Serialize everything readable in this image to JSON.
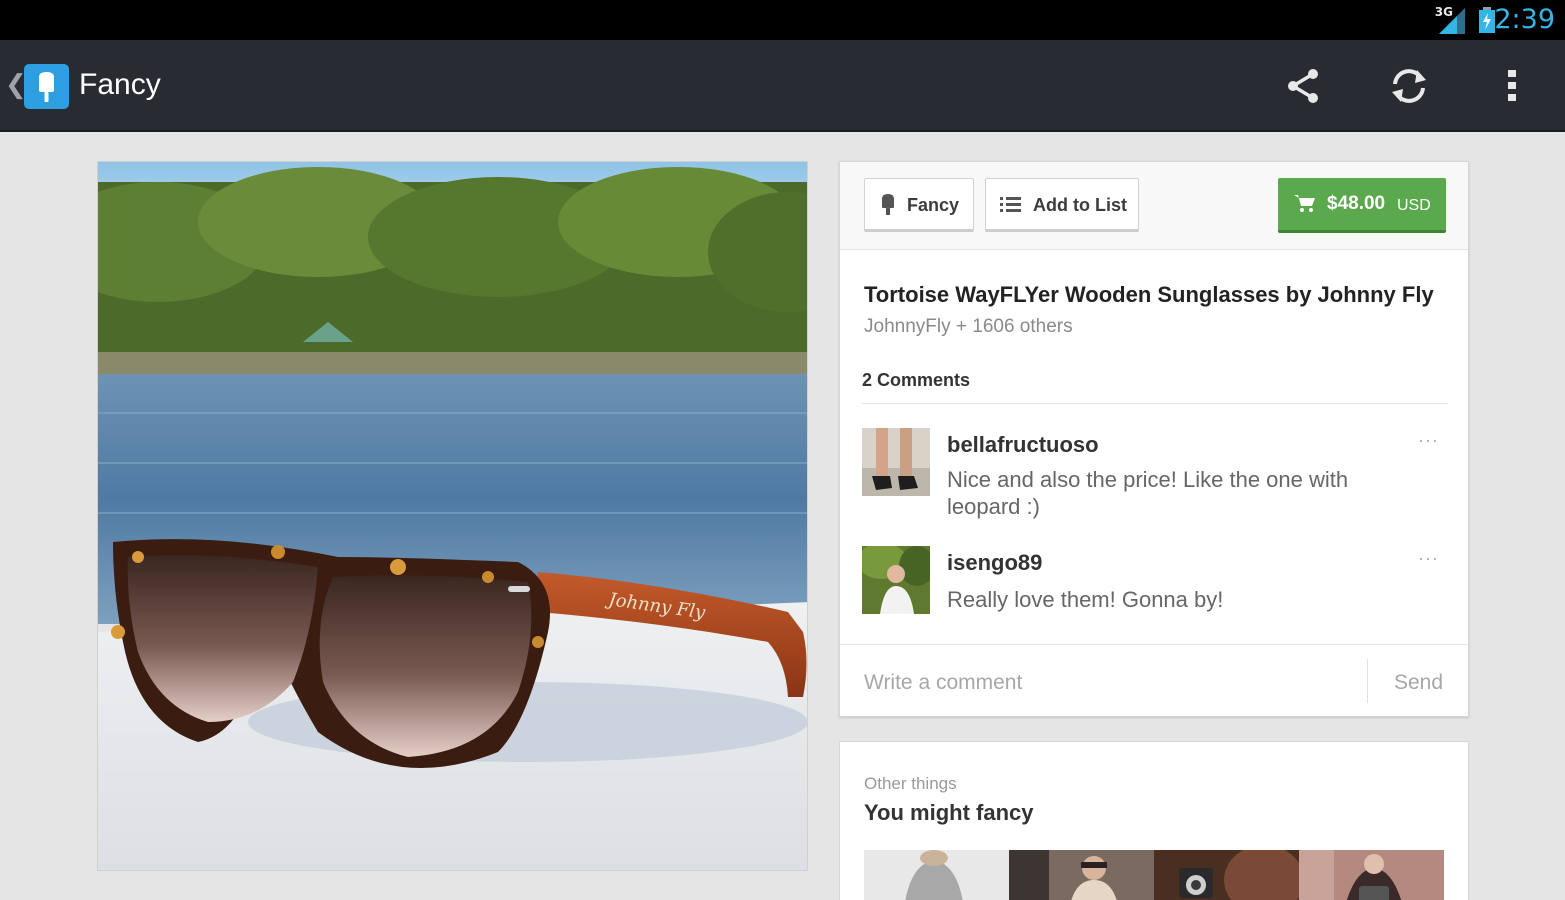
{
  "status_bar": {
    "network": "3G",
    "time": "2:39",
    "signal_icon": "signal-bars-icon",
    "battery_icon": "battery-charging-icon",
    "clock_color": "#33b5e5"
  },
  "action_bar": {
    "back_icon": "chevron-left-icon",
    "app_icon": "fancy-popsicle-icon",
    "title": "Fancy",
    "actions": [
      "share-icon",
      "refresh-icon",
      "overflow-menu-icon"
    ]
  },
  "product": {
    "image": "tortoise-wayflyer-sunglasses-photo",
    "buttons": {
      "fancy_label": "Fancy",
      "add_to_list_label": "Add to List"
    },
    "price": {
      "amount": "$48.00",
      "currency": "USD",
      "color": "#5aa94c"
    },
    "title": "Tortoise WayFLYer Wooden Sunglasses by Johnny Fly",
    "subtitle": "JohnnyFly + 1606 others"
  },
  "comments": {
    "count_label": "2 Comments",
    "items": [
      {
        "user": "bellafructuoso",
        "text": "Nice and also the price! Like the one with leopard :)",
        "more": "···"
      },
      {
        "user": "isengo89",
        "text": "Really love them! Gonna by!",
        "more": "···"
      }
    ],
    "input_placeholder": "Write a comment",
    "send_label": "Send"
  },
  "other_things": {
    "caption": "Other things",
    "heading": "You might fancy"
  }
}
